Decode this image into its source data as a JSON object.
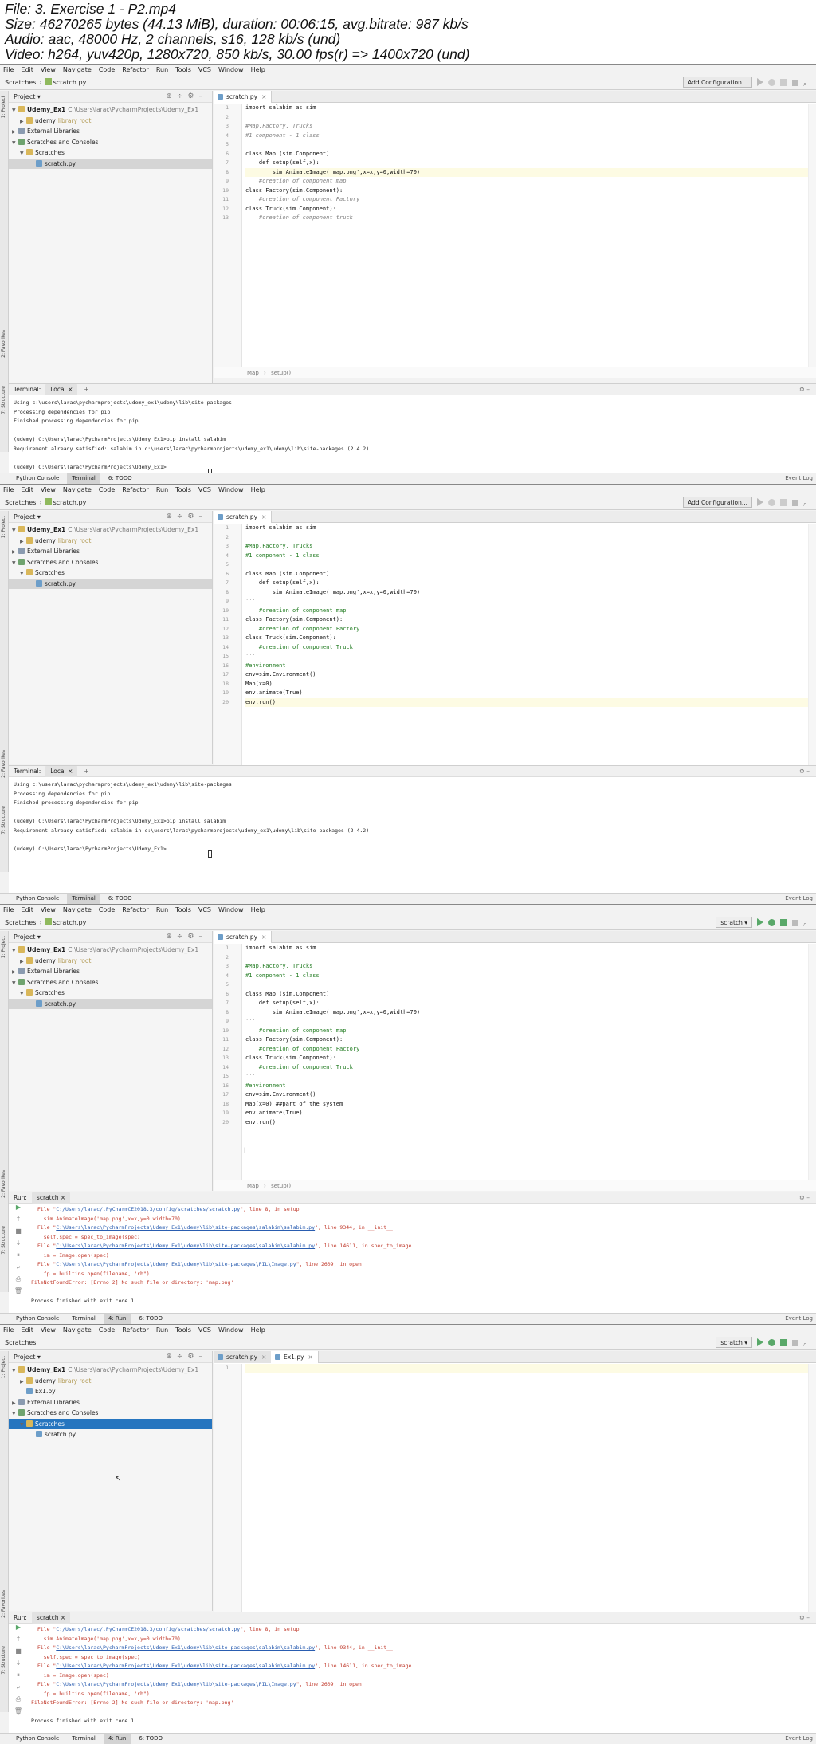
{
  "info": {
    "file": "File: 3. Exercise 1 - P2.mp4",
    "size": "Size: 46270265 bytes (44.13 MiB), duration: 00:06:15, avg.bitrate: 987 kb/s",
    "audio": "Audio: aac, 48000 Hz, 2 channels, s16, 128 kb/s (und)",
    "video": "Video: h264, yuv420p, 1280x720, 850 kb/s, 30.00 fps(r) => 1400x720 (und)"
  },
  "menu": [
    "File",
    "Edit",
    "View",
    "Navigate",
    "Code",
    "Refactor",
    "Run",
    "Tools",
    "VCS",
    "Window",
    "Help"
  ],
  "nav": {
    "scratches": "Scratches",
    "file": "scratch.py",
    "add_config": "Add Configuration...",
    "run_config": "scratch"
  },
  "project": {
    "title": "Project",
    "root": "Udemy_Ex1",
    "root_path": "C:\\Users\\larac\\PycharmProjects\\Udemy_Ex1",
    "udemy": "udemy",
    "library_root": "library root",
    "ex1": "Ex1.py",
    "external": "External Libraries",
    "scratches_consoles": "Scratches and Consoles",
    "scratches": "Scratches",
    "scratch_file": "scratch.py"
  },
  "editor": {
    "tab1": "scratch.py",
    "tab2": "Ex1.py",
    "crumb_map": "Map",
    "crumb_setup": "setup()"
  },
  "code1": [
    "import salabim as sim",
    "",
    "#Map,Factory, Trucks",
    "#1 component - 1 class",
    "",
    "class Map (sim.Component):",
    "    def setup(self,x):",
    "        sim.AnimateImage('map.png',x=x,y=0,width=70)",
    "    #creation of component map",
    "class Factory(sim.Component):",
    "    #creation of component Factory",
    "class Truck(sim.Component):",
    "    #creation of component truck"
  ],
  "code2": [
    "import salabim as sim",
    "",
    "#Map,Factory, Trucks",
    "#1 component - 1 class",
    "",
    "class Map (sim.Component):",
    "    def setup(self,x):",
    "        sim.AnimateImage('map.png',x=x,y=0,width=70)",
    "'''",
    "    #creation of component map",
    "class Factory(sim.Component):",
    "    #creation of component Factory",
    "class Truck(sim.Component):",
    "    #creation of component Truck",
    "'''",
    "#environment",
    "env=sim.Environment()",
    "Map(x=0)",
    "env.animate(True)",
    "env.run()"
  ],
  "code3": [
    "import salabim as sim",
    "",
    "#Map,Factory, Trucks",
    "#1 component - 1 class",
    "",
    "class Map (sim.Component):",
    "    def setup(self,x):",
    "        sim.AnimateImage('map.png',x=x,y=0,width=70)",
    "'''",
    "    #creation of component map",
    "class Factory(sim.Component):",
    "    #creation of component Factory",
    "class Truck(sim.Component):",
    "    #creation of component Truck",
    "'''",
    "#environment",
    "env=sim.Environment()",
    "Map(x=0) ##part of the system",
    "env.animate(True)",
    "env.run()"
  ],
  "terminal": {
    "label": "Terminal:",
    "local": "Local",
    "lines": [
      "Using c:\\users\\larac\\pycharmprojects\\udemy_ex1\\udemy\\lib\\site-packages",
      "Processing dependencies for pip",
      "Finished processing dependencies for pip",
      "",
      "(udemy) C:\\Users\\larac\\PycharmProjects\\Udemy_Ex1>pip install salabim",
      "Requirement already satisfied: salabim in c:\\users\\larac\\pycharmprojects\\udemy_ex1\\udemy\\lib\\site-packages (2.4.2)",
      "",
      "(udemy) C:\\Users\\larac\\PycharmProjects\\Udemy_Ex1>"
    ]
  },
  "run": {
    "label": "Run:",
    "tab": "scratch",
    "l1a": "  File \"",
    "l1link": "C:/Users/larac/.PyCharmCE2018.3/config/scratches/scratch.py",
    "l1b": "\", line 8, in setup",
    "l2": "    sim.AnimateImage('map.png',x=x,y=0,width=70)",
    "l3a": "  File \"",
    "l3link": "C:\\Users\\larac\\PycharmProjects\\Udemy_Ex1\\udemy\\lib\\site-packages\\salabim\\salabim.py",
    "l3b": "\", line 9344, in __init__",
    "l4": "    self.spec = spec_to_image(spec)",
    "l5a": "  File \"",
    "l5link": "C:\\Users\\larac\\PycharmProjects\\Udemy_Ex1\\udemy\\lib\\site-packages\\salabim\\salabim.py",
    "l5b": "\", line 14611, in spec_to_image",
    "l6": "    im = Image.open(spec)",
    "l7a": "  File \"",
    "l7link": "C:\\Users\\larac\\PycharmProjects\\Udemy_Ex1\\udemy\\lib\\site-packages\\PIL\\Image.py",
    "l7b": "\", line 2609, in open",
    "l8": "    fp = builtins.open(filename, \"rb\")",
    "l9": "FileNotFoundError: [Errno 2] No such file or directory: 'map.png'",
    "l11": "Process finished with exit code 1"
  },
  "status": {
    "console": "Python Console",
    "terminal": "Terminal",
    "run": "4: Run",
    "todo": "6: TODO",
    "event": "Event Log"
  },
  "side": {
    "project": "1: Project",
    "favorites": "2: Favorites",
    "structure": "7: Structure"
  }
}
